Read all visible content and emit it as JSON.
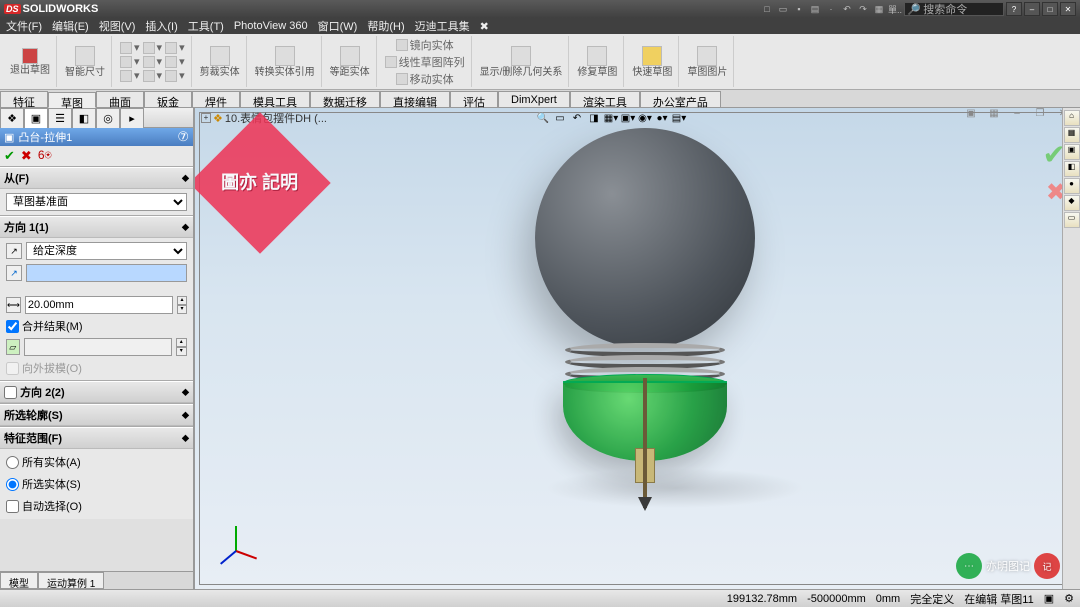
{
  "app": {
    "name": "SOLIDWORKS",
    "search_placeholder": "搜索命令"
  },
  "menu": [
    "文件(F)",
    "编辑(E)",
    "视图(V)",
    "插入(I)",
    "工具(T)",
    "PhotoView 360",
    "窗口(W)",
    "帮助(H)",
    "迈迪工具集",
    "✖"
  ],
  "ribbon": {
    "exit": "退出草图",
    "smart": "智能尺寸",
    "trim": "剪裁实体",
    "convert": "转换实体引用",
    "offset": "等距实体",
    "mirror": "镜向实体",
    "pattern": "线性草图阵列",
    "move": "移动实体",
    "display": "显示/删除几何关系",
    "repair": "修复草图",
    "quick": "快速草图",
    "pic": "草图图片"
  },
  "tabs": [
    "特征",
    "草图",
    "曲面",
    "钣金",
    "焊件",
    "模具工具",
    "数据迁移",
    "直接编辑",
    "评估",
    "DimXpert",
    "渲染工具",
    "办公室产品"
  ],
  "active_tab": "草图",
  "document": "10.表情包摆件DH  (...",
  "pm": {
    "title": "凸台-拉伸1",
    "from_label": "从(F)",
    "from_value": "草图基准面",
    "dir1_label": "方向 1(1)",
    "end_condition": "给定深度",
    "depth_value": "20.00mm",
    "merge_label": "合并结果(M)",
    "draft_label": "向外拔模(O)",
    "dir2_label": "方向 2(2)",
    "contour_label": "所选轮廓(S)",
    "scope_label": "特征范围(F)",
    "scope_all": "所有实体(A)",
    "scope_sel": "所选实体(S)",
    "auto_sel": "自动选择(O)",
    "bottom_tabs": [
      "模型",
      "运动算例 1"
    ]
  },
  "status": {
    "a": "199132.78mm",
    "b": "-500000mm",
    "c": "0mm",
    "d": "完全定义",
    "e": "在编辑 草图11"
  },
  "watermark_text": "圖亦\n記明",
  "watermark2_text": "亦明图记"
}
